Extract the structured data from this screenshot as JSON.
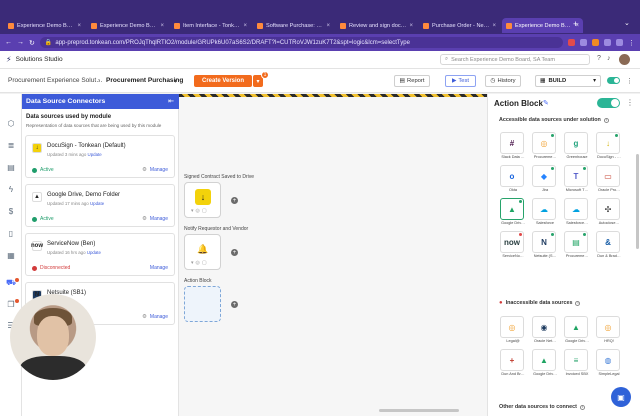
{
  "browser": {
    "tabs": [
      {
        "label": "Experience Demo Boo…",
        "active": false
      },
      {
        "label": "Experience Demo Boo…",
        "active": false
      },
      {
        "label": "Item Interface - Tonka…",
        "active": false
      },
      {
        "label": "Software Purchase: Hi…",
        "active": false
      },
      {
        "label": "Review and sign docu…",
        "active": false
      },
      {
        "label": "Purchase Order - Net…",
        "active": false
      },
      {
        "label": "Experience Demo Boo…",
        "active": true
      }
    ],
    "url": "app-preprod.tonkean.com/PROJqThqlRTIO2/module/GRUPk6U07aS6S2/DRAFT?l=CUTRoVJW1zuK7T2&spt=logic&lcm=selectType"
  },
  "app": {
    "studio_name": "Solutions Studio",
    "search_placeholder": "Search Experience Demo Board, SA Team"
  },
  "subheader": {
    "breadcrumb_parent": "Procurement Experience Solut…",
    "breadcrumb_current": "Procurement Purchasing",
    "create_version": "Create Version",
    "notification_count": "1",
    "report": "Report",
    "test": "Test",
    "history": "History",
    "build": "BUILD"
  },
  "connectors": {
    "header": "Data Source Connectors",
    "title": "Data sources used by module",
    "description": "Representation of data sources that are being used by this module",
    "cards": [
      {
        "name": "DocuSign - Tonkean (Default)",
        "updated": "Updated 3 mins ago",
        "update_link": "Update",
        "status": "Active",
        "manage": "Manage",
        "ok": true,
        "logo_color": "#f3d20b",
        "logo_text": "↓"
      },
      {
        "name": "Google Drive, Demo Folder",
        "updated": "Updated 17 mins ago",
        "update_link": "Update",
        "status": "Active",
        "manage": "Manage",
        "ok": true,
        "logo_color": "#ffffff",
        "logo_text": "▲"
      },
      {
        "name": "ServiceNow (Ben)",
        "updated": "Updated 16 hrs ago",
        "update_link": "Update",
        "status": "Disconnected",
        "manage": "Manage",
        "ok": false,
        "logo_color": "#ffffff",
        "logo_text": "now"
      },
      {
        "name": "Netsuite (SB1)",
        "updated": "",
        "update_link": "",
        "status": "",
        "manage": "Manage",
        "ok": true,
        "logo_color": "#1d3a5f",
        "logo_text": "N"
      }
    ]
  },
  "canvas": {
    "nodes": [
      {
        "label": "Signed Contract Saved to Drive",
        "icon": "↓",
        "icon_bg": "#f3d20b",
        "icon_fg": "#222222"
      },
      {
        "label": "Notify Requestor and Vendor",
        "icon": "🔔",
        "icon_bg": "#ffffff",
        "icon_fg": "#e04a4a"
      },
      {
        "label": "Action Block",
        "icon": "",
        "icon_bg": "",
        "icon_fg": ""
      }
    ]
  },
  "action_block": {
    "title": "Action Block",
    "accessible_title": "Accessible data sources under solution",
    "inaccessible_title": "Inaccessible data sources",
    "other_title": "Other data sources to connect",
    "accessible": [
      {
        "label": "Slack Data …",
        "glyph": "#",
        "color": "#4a154b",
        "dot": ""
      },
      {
        "label": "Procureme…",
        "glyph": "◎",
        "color": "#f0a030",
        "dot": "green"
      },
      {
        "label": "Greenhouse",
        "glyph": "g",
        "color": "#24a47f",
        "dot": ""
      },
      {
        "label": "DocuSign - …",
        "glyph": "↓",
        "color": "#d4b40a",
        "dot": "green"
      },
      {
        "label": "Okta",
        "glyph": "o",
        "color": "#1662dd",
        "dot": ""
      },
      {
        "label": "Jira",
        "glyph": "◆",
        "color": "#2684ff",
        "dot": "green"
      },
      {
        "label": "Microsoft T…",
        "glyph": "T",
        "color": "#5059c9",
        "dot": "green"
      },
      {
        "label": "Oracle Pro…",
        "glyph": "▭",
        "color": "#c74634",
        "dot": ""
      },
      {
        "label": "Google Driv…",
        "glyph": "▲",
        "color": "#1fa463",
        "dot": "green"
      },
      {
        "label": "Salesforce",
        "glyph": "☁",
        "color": "#00a1e0",
        "dot": ""
      },
      {
        "label": "Salesforce…",
        "glyph": "☁",
        "color": "#00a1e0",
        "dot": ""
      },
      {
        "label": "Autoclose…",
        "glyph": "✣",
        "color": "#333333",
        "dot": ""
      },
      {
        "label": "ServiceNo…",
        "glyph": "now",
        "color": "#293e40",
        "dot": "red"
      },
      {
        "label": "Netsuite (S…",
        "glyph": "N",
        "color": "#1d3a5f",
        "dot": "green"
      },
      {
        "label": "Procureme…",
        "glyph": "▤",
        "color": "#1fa463",
        "dot": "green"
      },
      {
        "label": "Dun & Brad…",
        "glyph": "&",
        "color": "#1a5fa8",
        "dot": ""
      }
    ],
    "inaccessible": [
      {
        "label": "Legal@",
        "glyph": "◎",
        "color": "#f0a030",
        "dot": ""
      },
      {
        "label": "Oracle Net…",
        "glyph": "◉",
        "color": "#1d3a5f",
        "dot": ""
      },
      {
        "label": "Google Driv…",
        "glyph": "▲",
        "color": "#1fa463",
        "dot": ""
      },
      {
        "label": "HRQ!",
        "glyph": "◎",
        "color": "#f0a030",
        "dot": ""
      },
      {
        "label": "Dun And Br…",
        "glyph": "+",
        "color": "#c0392b",
        "dot": ""
      },
      {
        "label": "Google Driv…",
        "glyph": "▲",
        "color": "#1fa463",
        "dot": ""
      },
      {
        "label": "Invoiced SBX",
        "glyph": "≡",
        "color": "#27a36b",
        "dot": ""
      },
      {
        "label": "SimpleLegal",
        "glyph": "◍",
        "color": "#3c7bd6",
        "dot": ""
      }
    ]
  },
  "colors": {
    "accent": "#f26b1d",
    "panel_header": "#3d5bd9",
    "toggle_on": "#2bb596"
  }
}
